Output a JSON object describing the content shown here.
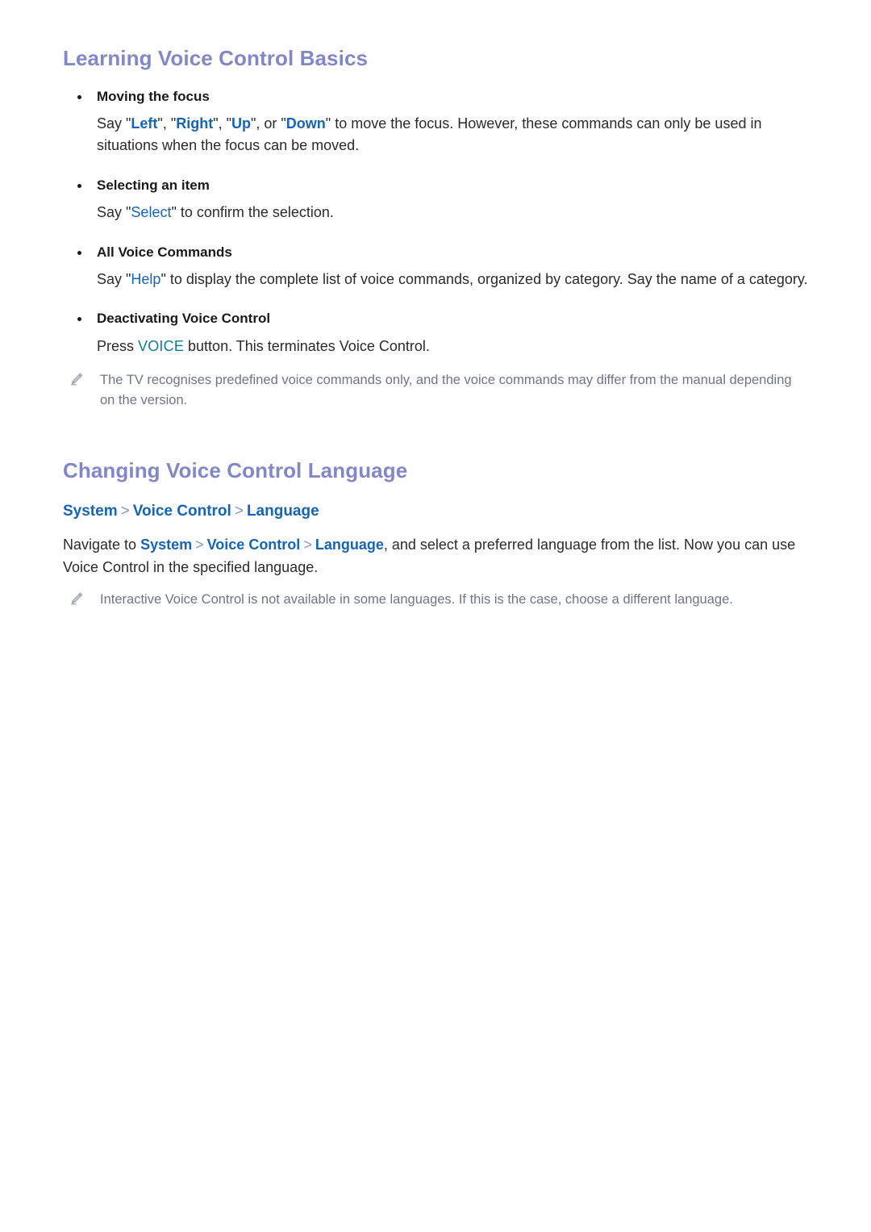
{
  "colors": {
    "heading": "#8287c8",
    "command_blue": "#1565b5",
    "voice_key_teal": "#0d7d96",
    "note_gray": "#6f7487",
    "body_text": "#2b2b2b",
    "breadcrumb_separator": "#7b9bc4"
  },
  "sections": [
    {
      "title": "Learning Voice Control Basics",
      "bullets": [
        {
          "head": "Moving the focus",
          "body_prefix": "Say ",
          "commands": [
            "Left",
            "Right",
            "Up",
            "Down"
          ],
          "body_middle_1": ", ",
          "body_middle_2": ", or ",
          "body_suffix": " to move the focus. However, these commands can only be used in situations when the focus can be moved."
        },
        {
          "head": "Selecting an item",
          "body_prefix": "Say ",
          "command": "Select",
          "body_suffix": " to confirm the selection."
        },
        {
          "head": "All Voice Commands",
          "body_prefix": "Say ",
          "command": "Help",
          "body_suffix": " to display the complete list of voice commands, organized by category. Say the name of a category."
        },
        {
          "head": "Deactivating Voice Control",
          "body_prefix": "Press ",
          "key": "VOICE",
          "body_suffix": " button. This terminates Voice Control."
        }
      ],
      "note": "The TV recognises predefined voice commands only, and the voice commands may differ from the manual depending on the version."
    },
    {
      "title": "Changing Voice Control Language",
      "breadcrumb": [
        "System",
        "Voice Control",
        "Language"
      ],
      "breadcrumb_separator": ">",
      "paragraph_prefix": "Navigate to ",
      "paragraph_suffix": ", and select a preferred language from the list. Now you can use Voice Control in the specified language.",
      "note": "Interactive Voice Control is not available in some languages. If this is the case, choose a different language."
    }
  ],
  "icons": {
    "note_icon_name": "pencil-icon"
  }
}
